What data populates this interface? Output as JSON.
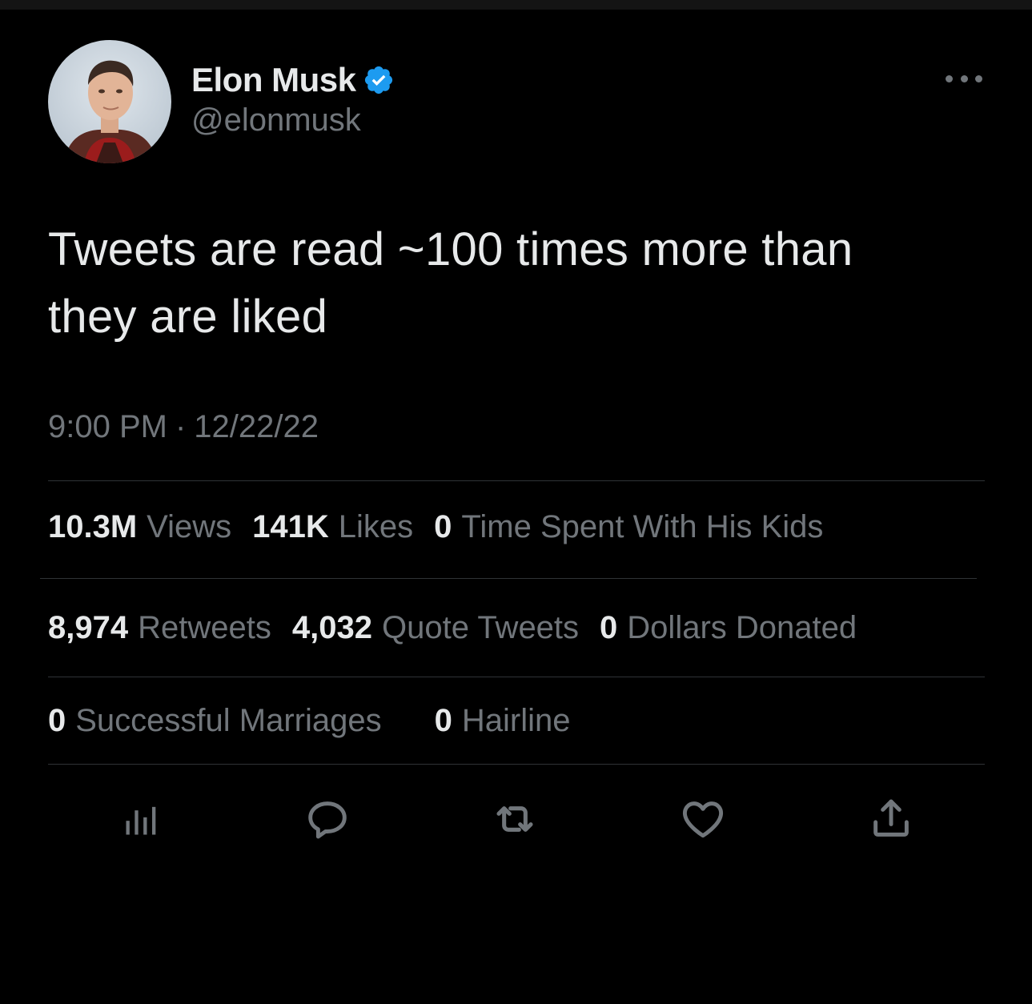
{
  "author": {
    "name": "Elon Musk",
    "handle": "@elonmusk",
    "verified": true,
    "verified_color": "#1d9bf0"
  },
  "tweet": {
    "text_line1": "Tweets are read ~100 times more than",
    "text_line2": "they are liked",
    "time": "9:00 PM",
    "separator": "·",
    "date": "12/22/22"
  },
  "stats_row1": [
    {
      "num": "10.3M",
      "label": "Views"
    },
    {
      "num": "141K",
      "label": "Likes"
    },
    {
      "num": "0",
      "label": "Time Spent With His Kids"
    }
  ],
  "stats_row2": [
    {
      "num": "8,974",
      "label": "Retweets"
    },
    {
      "num": "4,032",
      "label": "Quote Tweets"
    },
    {
      "num": "0",
      "label": "Dollars Donated"
    }
  ],
  "stats_row3": [
    {
      "num": "0",
      "label": "Successful Marriages"
    },
    {
      "num": "0",
      "label": "Hairline"
    }
  ],
  "actions": [
    "analytics-icon",
    "reply-icon",
    "retweet-icon",
    "like-icon",
    "share-icon"
  ],
  "icons": {
    "more": "more-icon",
    "verified": "verified-badge-icon"
  },
  "colors": {
    "background": "#000000",
    "text_primary": "#e7e9ea",
    "text_secondary": "#71767b",
    "divider": "#2f3336",
    "accent": "#1d9bf0"
  }
}
